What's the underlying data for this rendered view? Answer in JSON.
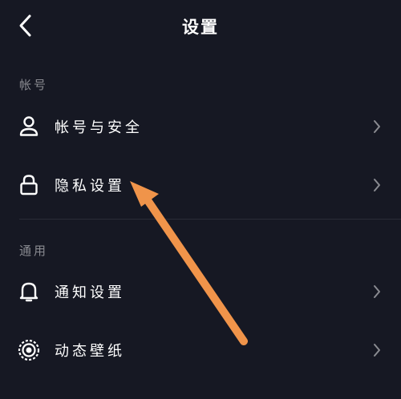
{
  "header": {
    "title": "设置",
    "back_icon": "chevron-left-icon"
  },
  "sections": [
    {
      "label": "帐号",
      "items": [
        {
          "label": "帐号与安全",
          "icon": "user-icon"
        },
        {
          "label": "隐私设置",
          "icon": "lock-icon"
        }
      ]
    },
    {
      "label": "通用",
      "items": [
        {
          "label": "通知设置",
          "icon": "bell-icon"
        },
        {
          "label": "动态壁纸",
          "icon": "live-wallpaper-icon"
        }
      ]
    }
  ],
  "colors": {
    "background": "#161823",
    "text": "#ffffff",
    "section_label": "#8a8b91",
    "chevron": "#8a8b91",
    "divider": "#2a2c37",
    "annotation_arrow": "#f0944a"
  }
}
